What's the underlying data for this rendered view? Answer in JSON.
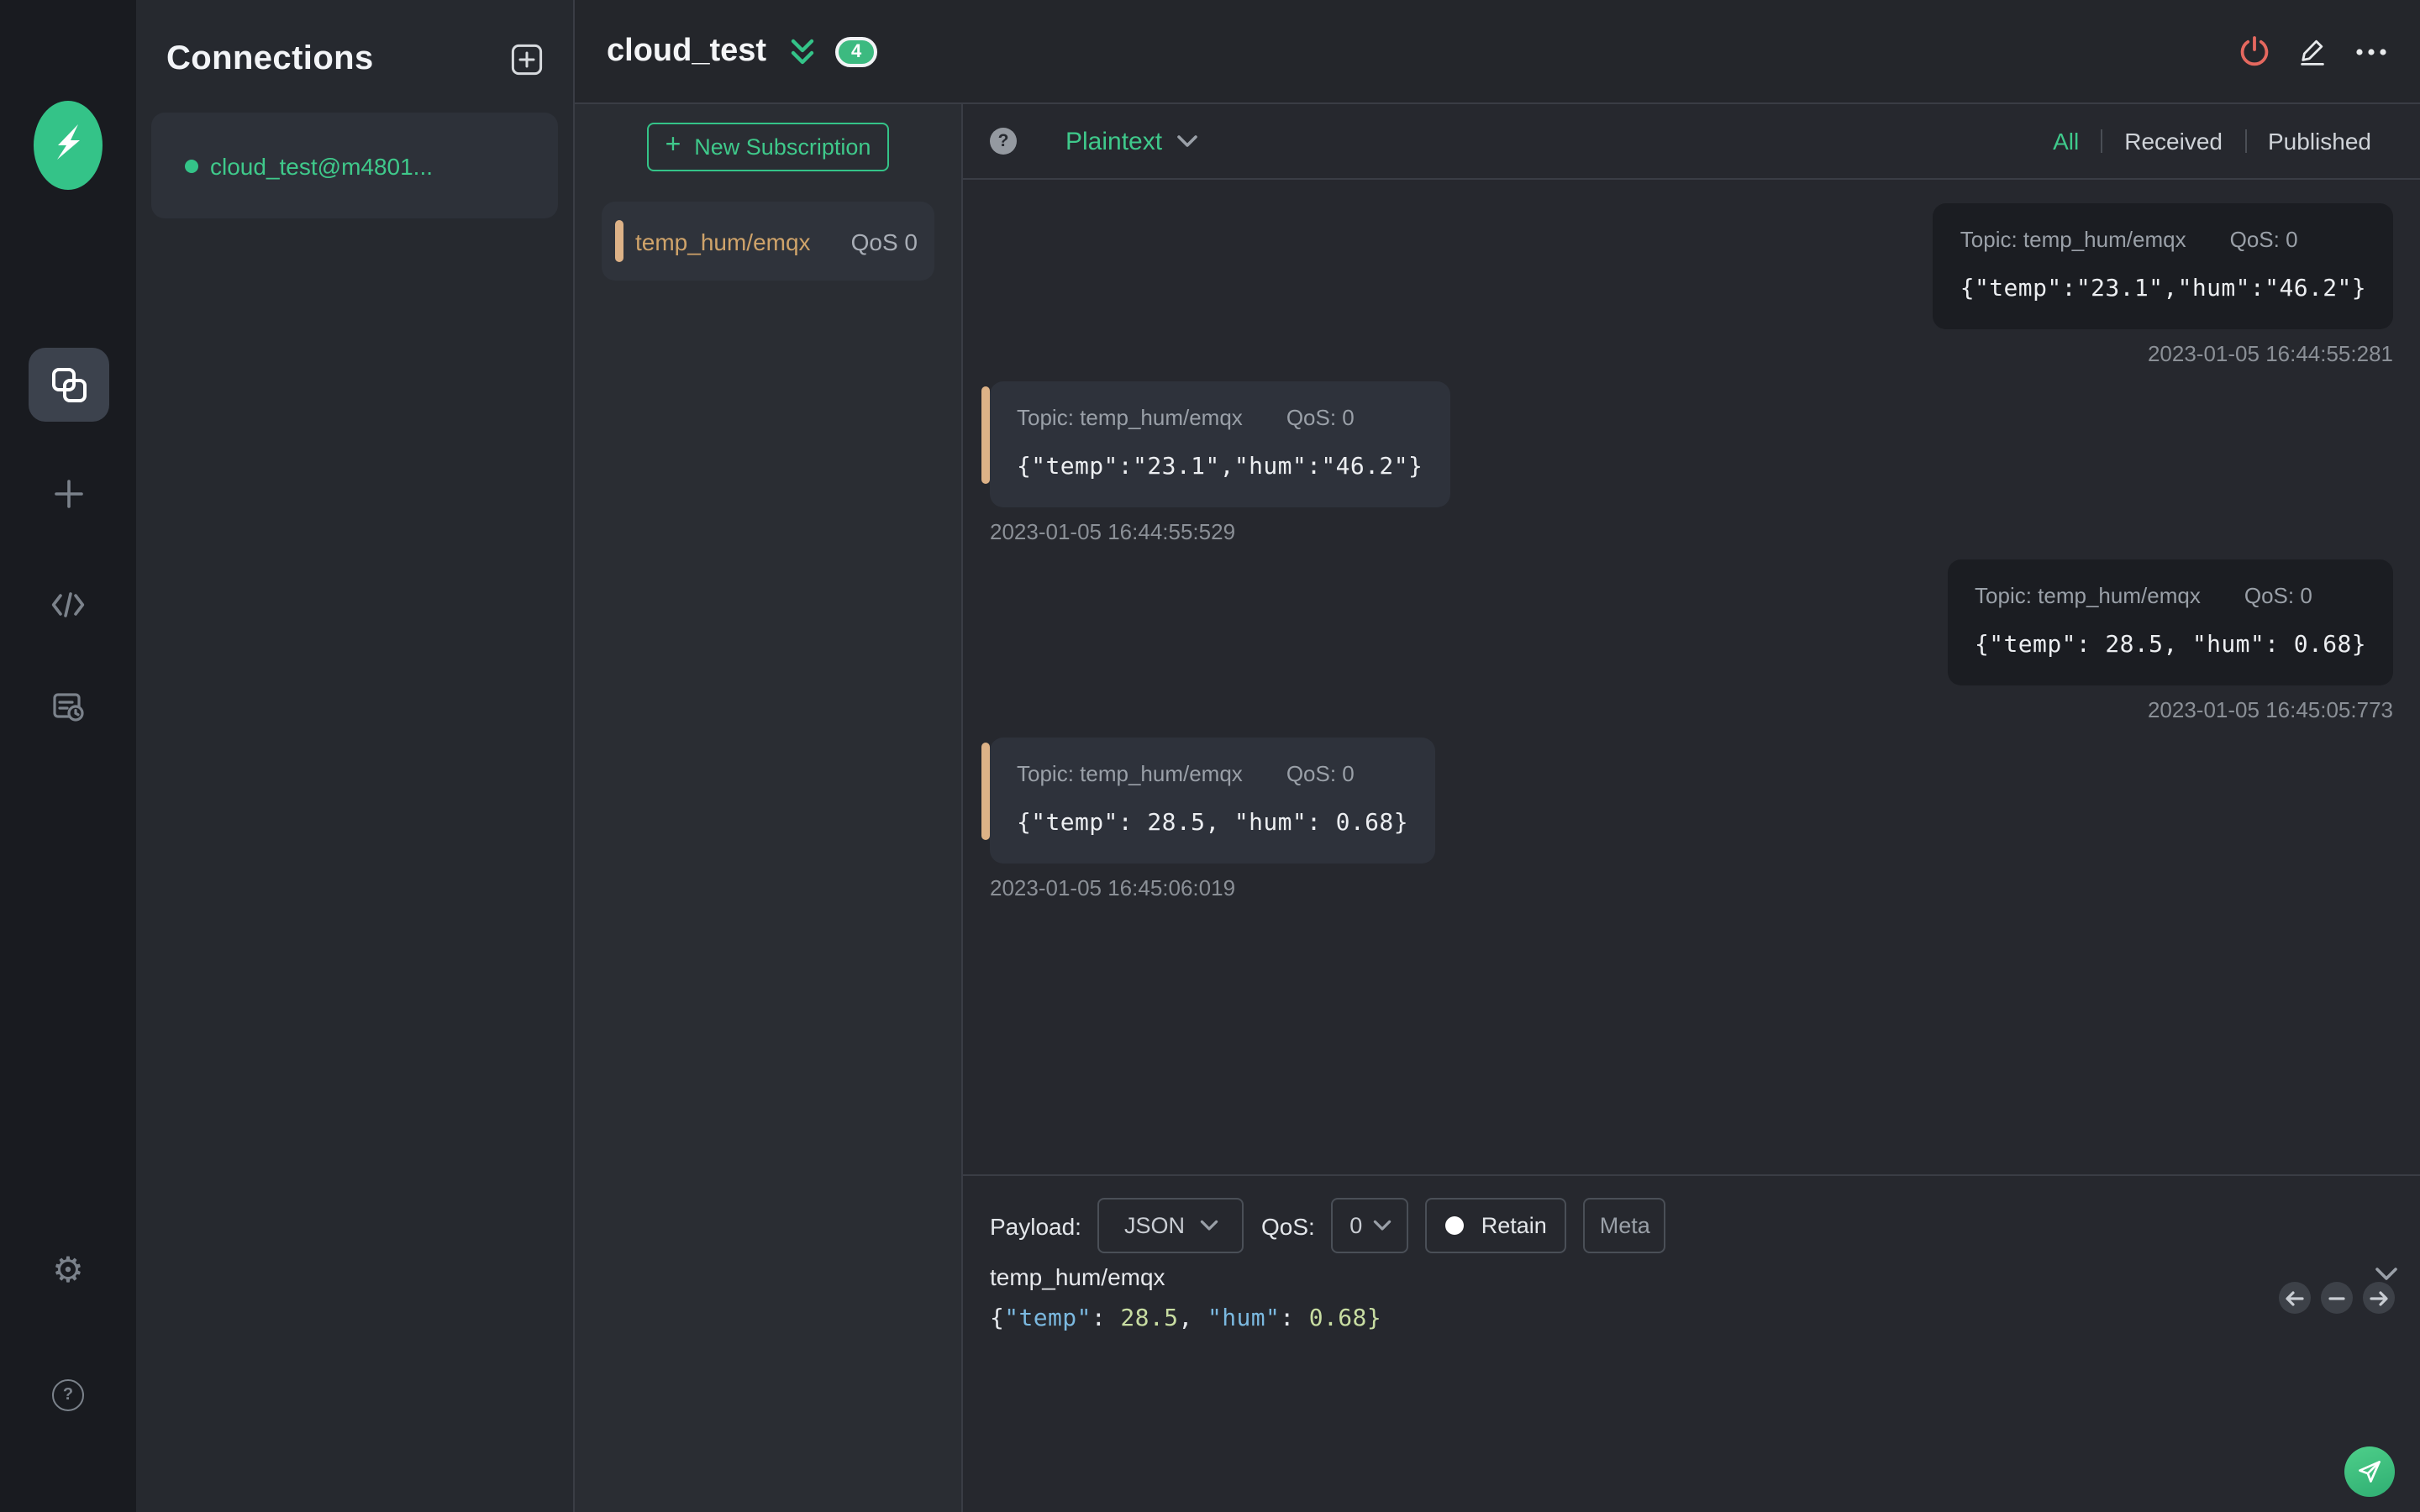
{
  "colors": {
    "accent_green": "#34c388",
    "topic_orange": "#cfa36a",
    "accent_bar_orange": "#ddb287",
    "danger_red": "#e5685f",
    "badge_green": "#3cba80",
    "received_bubble": "#2e323b",
    "published_bubble": "#1b1d22"
  },
  "sidebar": {
    "icons": [
      {
        "name": "mqttx-logo",
        "glyph": "lightning-x"
      },
      {
        "name": "connections-icon",
        "glyph": "overlapping-squares",
        "active": true
      },
      {
        "name": "new-connection-icon",
        "glyph": "plus"
      },
      {
        "name": "script-icon",
        "glyph": "code-brackets"
      },
      {
        "name": "log-icon",
        "glyph": "document-clock"
      },
      {
        "name": "settings-icon",
        "glyph": "gear",
        "char": "⚙"
      },
      {
        "name": "help-icon",
        "glyph": "question-circle",
        "char": "?"
      }
    ]
  },
  "connections": {
    "title": "Connections",
    "add_button": "add-connection",
    "items": [
      {
        "name": "cloud_test@m4801...",
        "status": "connected"
      }
    ]
  },
  "header": {
    "connection_name": "cloud_test",
    "unread_count": "4",
    "actions": [
      "disconnect-power",
      "edit-pencil",
      "more-ellipsis"
    ]
  },
  "subscriptions": {
    "new_button_label": "New Subscription",
    "new_button_plus": "+",
    "items": [
      {
        "topic": "temp_hum/emqx",
        "qos": "QoS 0"
      }
    ]
  },
  "messages": {
    "format_selected": "Plaintext",
    "help_glyph": "?",
    "filters": {
      "items": [
        {
          "label": "All",
          "active": true
        },
        {
          "label": "Received",
          "active": false
        },
        {
          "label": "Published",
          "active": false
        }
      ]
    },
    "items": [
      {
        "direction": "published",
        "topic_label": "Topic: temp_hum/emqx",
        "qos_label": "QoS: 0",
        "payload": "{\"temp\":\"23.1\",\"hum\":\"46.2\"}",
        "timestamp": "2023-01-05 16:44:55:281"
      },
      {
        "direction": "received",
        "topic_label": "Topic: temp_hum/emqx",
        "qos_label": "QoS: 0",
        "payload": "{\"temp\":\"23.1\",\"hum\":\"46.2\"}",
        "timestamp": "2023-01-05 16:44:55:529"
      },
      {
        "direction": "published",
        "topic_label": "Topic: temp_hum/emqx",
        "qos_label": "QoS: 0",
        "payload": "{\"temp\": 28.5, \"hum\": 0.68}",
        "timestamp": "2023-01-05 16:45:05:773"
      },
      {
        "direction": "received",
        "topic_label": "Topic: temp_hum/emqx",
        "qos_label": "QoS: 0",
        "payload": "{\"temp\": 28.5, \"hum\": 0.68}",
        "timestamp": "2023-01-05 16:45:06:019"
      }
    ]
  },
  "publish": {
    "payload_label": "Payload:",
    "payload_format": "JSON",
    "qos_label": "QoS:",
    "qos_value": "0",
    "retain_label": "Retain",
    "meta_label": "Meta",
    "topic": "temp_hum/emqx",
    "payload": "{\"temp\": 28.5, \"hum\": 0.68}",
    "payload_tokens": [
      {
        "text": "{",
        "type": "punct"
      },
      {
        "text": "\"temp\"",
        "type": "key"
      },
      {
        "text": ": ",
        "type": "punct"
      },
      {
        "text": "28.5",
        "type": "number"
      },
      {
        "text": ", ",
        "type": "punct"
      },
      {
        "text": "\"hum\"",
        "type": "key"
      },
      {
        "text": ": ",
        "type": "punct"
      },
      {
        "text": "0.68",
        "type": "number"
      },
      {
        "text": "}",
        "type": "number"
      }
    ],
    "history_nav": [
      "previous-message",
      "clear-message",
      "next-message"
    ],
    "send_button": "send"
  }
}
